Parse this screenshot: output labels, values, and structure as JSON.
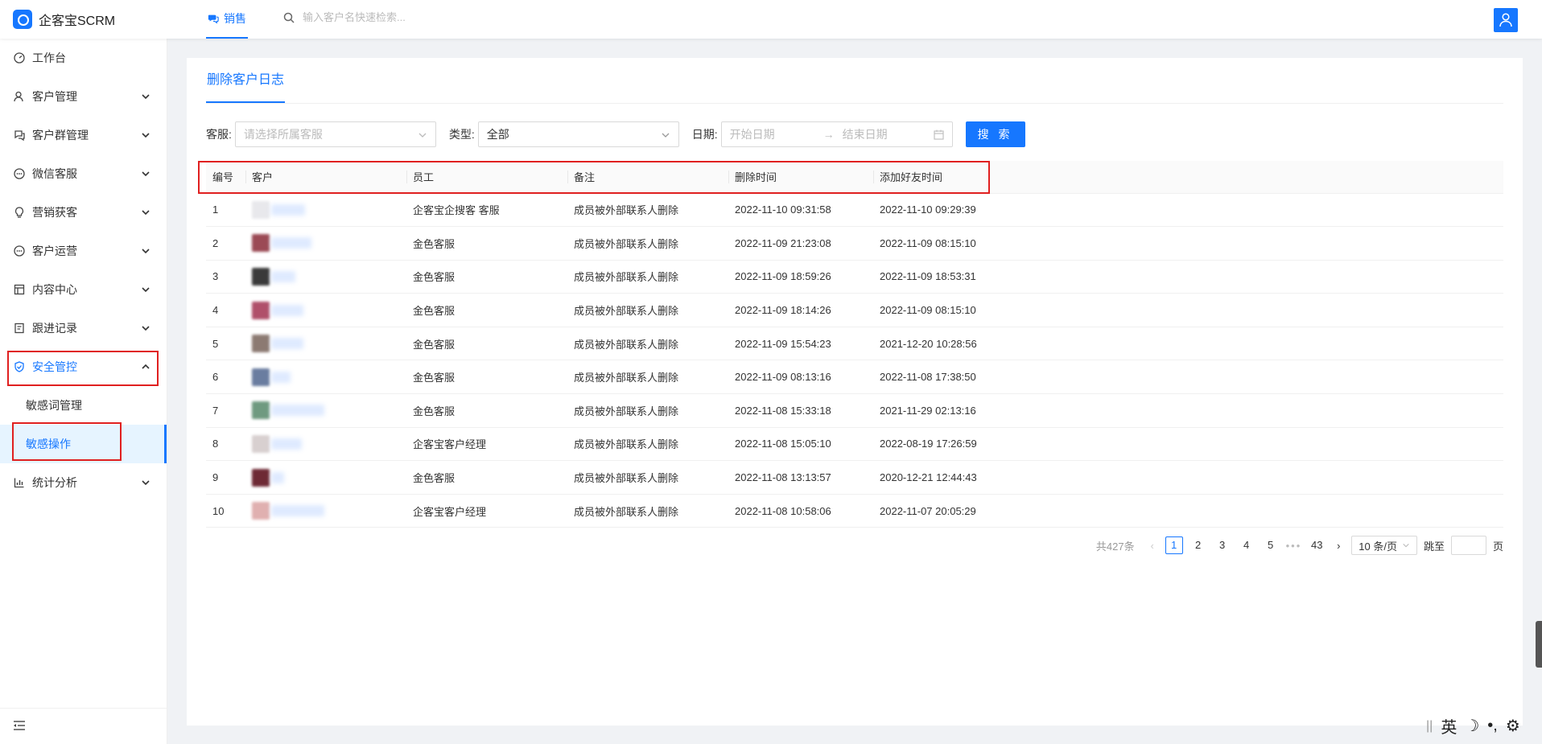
{
  "app": {
    "title": "企客宝SCRM"
  },
  "header": {
    "tab_label": "销售",
    "search_placeholder": "输入客户名快速检索..."
  },
  "sidebar": {
    "items": [
      {
        "label": "工作台",
        "icon": "dashboard-icon"
      },
      {
        "label": "客户管理",
        "icon": "user-icon"
      },
      {
        "label": "客户群管理",
        "icon": "chat-group-icon"
      },
      {
        "label": "微信客服",
        "icon": "wechat-service-icon"
      },
      {
        "label": "营销获客",
        "icon": "bulb-icon"
      },
      {
        "label": "客户运营",
        "icon": "operation-icon"
      },
      {
        "label": "内容中心",
        "icon": "content-icon"
      },
      {
        "label": "跟进记录",
        "icon": "record-icon"
      },
      {
        "label": "安全管控",
        "icon": "shield-icon"
      },
      {
        "label": "统计分析",
        "icon": "chart-icon"
      }
    ],
    "security_sub": [
      "敏感词管理",
      "敏感操作"
    ]
  },
  "page": {
    "tab": "删除客户日志",
    "filters": {
      "service_label": "客服:",
      "service_placeholder": "请选择所属客服",
      "type_label": "类型:",
      "type_value": "全部",
      "date_label": "日期:",
      "start_placeholder": "开始日期",
      "end_placeholder": "结束日期",
      "search_button": "搜 索"
    }
  },
  "table": {
    "columns": [
      "编号",
      "客户",
      "员工",
      "备注",
      "删除时间",
      "添加好友时间"
    ],
    "rows": [
      {
        "no": "1",
        "staff": "企客宝企搜客 客服",
        "note": "成员被外部联系人删除",
        "deleted": "2022-11-10 09:31:58",
        "added": "2022-11-10 09:29:39"
      },
      {
        "no": "2",
        "staff": "金色客服",
        "note": "成员被外部联系人删除",
        "deleted": "2022-11-09 21:23:08",
        "added": "2022-11-09 08:15:10"
      },
      {
        "no": "3",
        "staff": "金色客服",
        "note": "成员被外部联系人删除",
        "deleted": "2022-11-09 18:59:26",
        "added": "2022-11-09 18:53:31"
      },
      {
        "no": "4",
        "staff": "金色客服",
        "note": "成员被外部联系人删除",
        "deleted": "2022-11-09 18:14:26",
        "added": "2022-11-09 08:15:10"
      },
      {
        "no": "5",
        "staff": "金色客服",
        "note": "成员被外部联系人删除",
        "deleted": "2022-11-09 15:54:23",
        "added": "2021-12-20 10:28:56"
      },
      {
        "no": "6",
        "staff": "金色客服",
        "note": "成员被外部联系人删除",
        "deleted": "2022-11-09 08:13:16",
        "added": "2022-11-08 17:38:50"
      },
      {
        "no": "7",
        "staff": "金色客服",
        "note": "成员被外部联系人删除",
        "deleted": "2022-11-08 15:33:18",
        "added": "2021-11-29 02:13:16"
      },
      {
        "no": "8",
        "staff": "企客宝客户经理",
        "note": "成员被外部联系人删除",
        "deleted": "2022-11-08 15:05:10",
        "added": "2022-08-19 17:26:59"
      },
      {
        "no": "9",
        "staff": "金色客服",
        "note": "成员被外部联系人删除",
        "deleted": "2022-11-08 13:13:57",
        "added": "2020-12-21 12:44:43"
      },
      {
        "no": "10",
        "staff": "企客宝客户经理",
        "note": "成员被外部联系人删除",
        "deleted": "2022-11-08 10:58:06",
        "added": "2022-11-07 20:05:29"
      }
    ]
  },
  "pagination": {
    "total": "共427条",
    "pages": [
      "1",
      "2",
      "3",
      "4",
      "5"
    ],
    "ellipsis": "•••",
    "last": "43",
    "current": "1",
    "page_size": "10 条/页",
    "jump_label": "跳至",
    "page_suffix": "页"
  },
  "ime": {
    "lang": "英"
  },
  "colors": {
    "accent": "#1677ff",
    "highlight": "#e02020"
  }
}
